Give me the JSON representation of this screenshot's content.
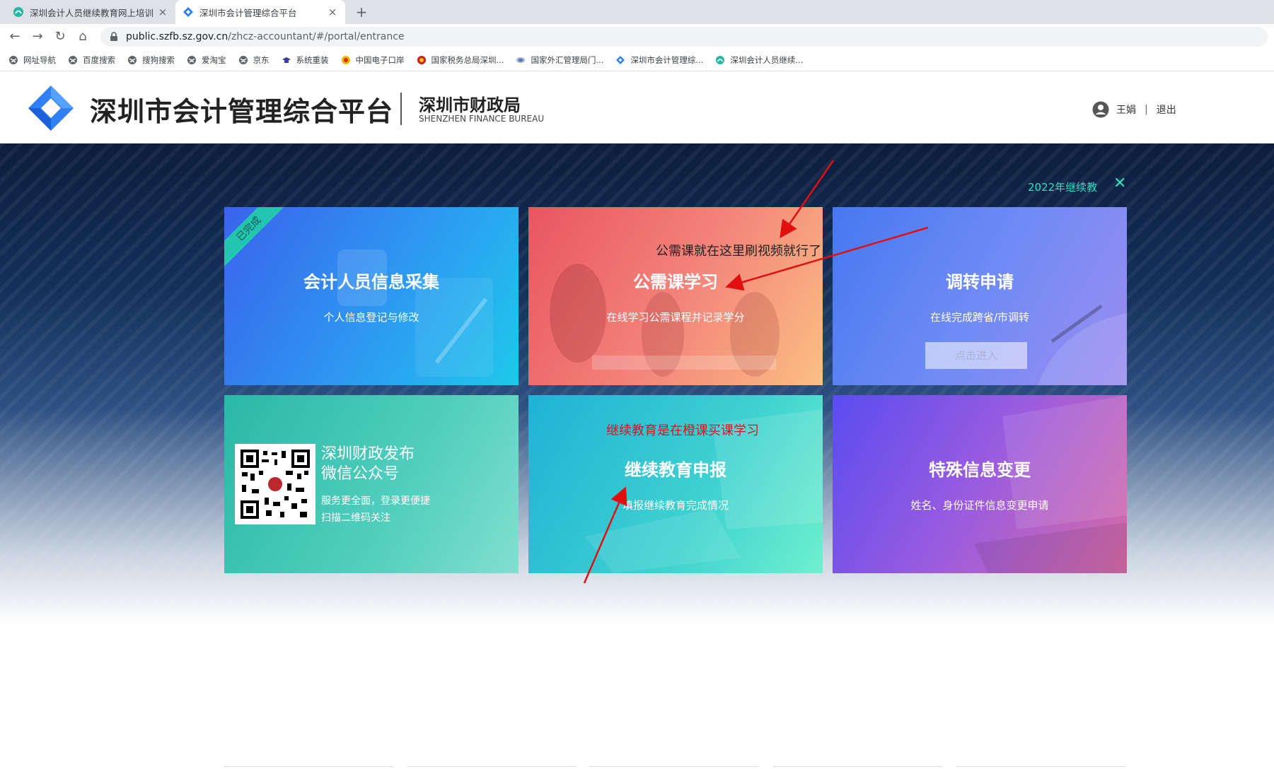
{
  "browser": {
    "tabs": [
      {
        "title": "深圳会计人员继续教育网上培训",
        "active": false,
        "icon": "teal-circle-icon"
      },
      {
        "title": "深圳市会计管理综合平台",
        "active": true,
        "icon": "blue-diamond-icon"
      }
    ],
    "new_tab_label": "+",
    "close_glyph": "×",
    "url_host": "public.szfb.sz.gov.cn",
    "url_path": "/zhcz-accountant/#/portal/entrance",
    "bookmarks": [
      {
        "label": "网址导航",
        "icon": "globe-icon"
      },
      {
        "label": "百度搜索",
        "icon": "globe-icon"
      },
      {
        "label": "搜狗搜索",
        "icon": "globe-icon"
      },
      {
        "label": "爱淘宝",
        "icon": "globe-icon"
      },
      {
        "label": "京东",
        "icon": "globe-icon"
      },
      {
        "label": "系统重装",
        "icon": "cap-icon"
      },
      {
        "label": "中国电子口岸",
        "icon": "emblem-icon"
      },
      {
        "label": "国家税务总局深圳...",
        "icon": "tax-emblem-icon"
      },
      {
        "label": "国家外汇管理局门...",
        "icon": "safe-icon"
      },
      {
        "label": "深圳市会计管理综...",
        "icon": "blue-diamond-icon"
      },
      {
        "label": "深圳会计人员继续...",
        "icon": "teal-circle-icon"
      }
    ]
  },
  "header": {
    "platform_title": "深圳市会计管理综合平台",
    "bureau_cn": "深圳市财政局",
    "bureau_en": "SHENZHEN FINANCE BUREAU",
    "user_name": "王娟",
    "separator": "|",
    "logout_label": "退出"
  },
  "notice": {
    "text": "2022年继续教",
    "close_glyph": "✕"
  },
  "cards": [
    {
      "title": "会计人员信息采集",
      "subtitle": "个人信息登记与修改",
      "badge": "已完成"
    },
    {
      "title": "公需课学习",
      "subtitle": "在线学习公需课程并记录学分"
    },
    {
      "title": "调转申请",
      "subtitle": "在线完成跨省/市调转",
      "button": "点击进入"
    },
    {
      "title": "深圳财政发布",
      "title2": "微信公众号",
      "subtitle": "服务更全面，登录更便捷",
      "subtitle2": "扫描二维码关注"
    },
    {
      "title": "继续教育申报",
      "subtitle": "填报继续教育完成情况"
    },
    {
      "title": "特殊信息变更",
      "subtitle": "姓名、身份证件信息变更申请"
    }
  ],
  "annotations": {
    "note1": "公需课就在这里刷视频就行了",
    "note2": "继续教育是在橙课买课学习"
  },
  "colors": {
    "accent_teal": "#2be0c0",
    "annotation_red": "#d8151b",
    "brand_blue": "#2f7ff5"
  }
}
